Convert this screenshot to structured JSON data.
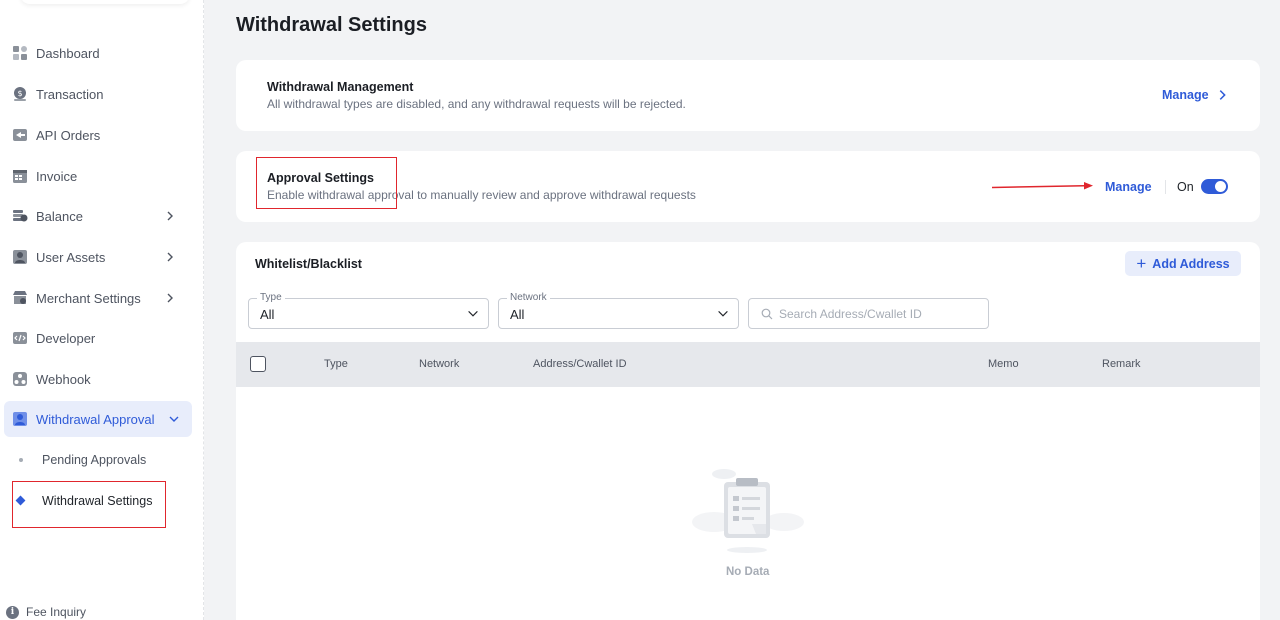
{
  "sidebar": {
    "items": [
      {
        "label": "Dashboard",
        "icon": "dashboard-icon"
      },
      {
        "label": "Transaction",
        "icon": "transaction-icon"
      },
      {
        "label": "API Orders",
        "icon": "api-orders-icon"
      },
      {
        "label": "Invoice",
        "icon": "invoice-icon"
      },
      {
        "label": "Balance",
        "icon": "balance-icon"
      },
      {
        "label": "User Assets",
        "icon": "user-assets-icon"
      },
      {
        "label": "Merchant Settings",
        "icon": "merchant-settings-icon"
      },
      {
        "label": "Developer",
        "icon": "developer-icon"
      },
      {
        "label": "Webhook",
        "icon": "webhook-icon"
      },
      {
        "label": "Withdrawal Approval",
        "icon": "withdrawal-approval-icon"
      }
    ],
    "sub_items": [
      {
        "label": "Pending Approvals"
      },
      {
        "label": "Withdrawal Settings"
      }
    ],
    "footer_label": "Fee Inquiry"
  },
  "page": {
    "title": "Withdrawal Settings"
  },
  "withdrawal_management": {
    "title": "Withdrawal Management",
    "description": "All withdrawal types are disabled, and any withdrawal requests will be rejected.",
    "manage_label": "Manage"
  },
  "approval_settings": {
    "title": "Approval Settings",
    "description": "Enable withdrawal approval to manually review and approve withdrawal requests",
    "manage_label": "Manage",
    "toggle_label": "On",
    "toggle_on": true
  },
  "whitelist": {
    "title": "Whitelist/Blacklist",
    "add_button_label": "Add Address",
    "filters": {
      "type_label": "Type",
      "type_value": "All",
      "network_label": "Network",
      "network_value": "All",
      "search_placeholder": "Search Address/Cwallet ID"
    },
    "columns": [
      "Type",
      "Network",
      "Address/Cwallet ID",
      "Memo",
      "Remark"
    ],
    "empty_text": "No Data"
  },
  "colors": {
    "accent": "#2f5bd8",
    "highlight": "#e0262d"
  }
}
